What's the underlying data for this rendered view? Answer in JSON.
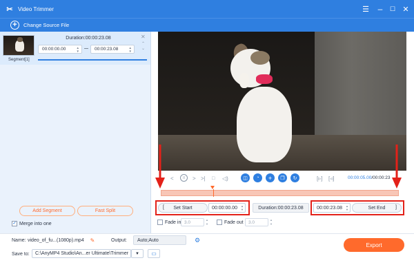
{
  "window": {
    "title": "Video Trimmer",
    "controls": [
      "minimize",
      "maximize",
      "close"
    ]
  },
  "toolbar": {
    "change_source_label": "Change Source File"
  },
  "segment": {
    "name": "Segment[1]",
    "duration_label": "Duration:00:00:23.08",
    "start_value": "00:00:00.00",
    "end_value": "00:00:23.08"
  },
  "left_actions": {
    "add_segment_label": "Add Segment",
    "fast_split_label": "Fast Split",
    "merge_label": "Merge into one",
    "merge_checked": true
  },
  "player": {
    "current_time": "00:00:05.00",
    "total_time": "/00:00:23",
    "progress": 0.22
  },
  "trim": {
    "set_start_label": "Set Start",
    "start_time": "00:00:00.00",
    "duration_label": "Duration:00:00:23.08",
    "end_time": "00:00:23.08",
    "set_end_label": "Set End",
    "fade_in_label": "Fade in",
    "fade_in_value": "3.0",
    "fade_out_label": "Fade out",
    "fade_out_value": "3.0"
  },
  "output": {
    "name_label": "Name:",
    "name_value": "video_of_fu...(1080p).mp4",
    "output_label": "Output:",
    "output_value": "Auto;Auto",
    "save_label": "Save to:",
    "save_path": "C:\\AnyMP4 Studio\\An...er Ultimate\\Trimmer",
    "export_label": "Export"
  },
  "colors": {
    "accent": "#2f7fe0",
    "orange": "#ff6a2c",
    "annotation_red": "#e32119",
    "timeline_fill": "#f8c6b6"
  }
}
